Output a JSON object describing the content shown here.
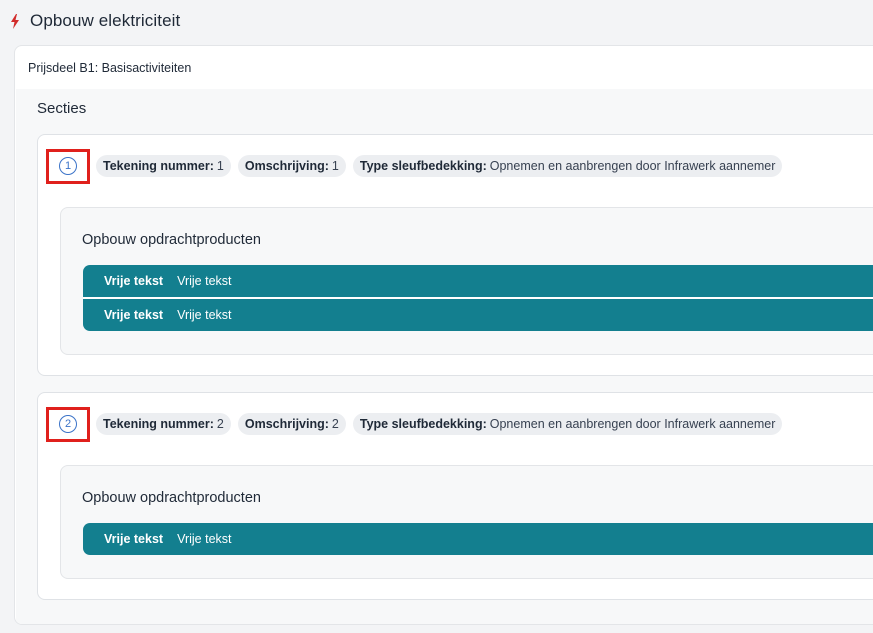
{
  "header": {
    "title": "Opbouw elektriciteit",
    "icon": "lightning-bolt-icon",
    "icon_color": "#d12b2b"
  },
  "card": {
    "title": "Prijsdeel B1: Basisactiviteiten"
  },
  "secties": {
    "title": "Secties",
    "sections": [
      {
        "number": "1",
        "pills": [
          {
            "label": "Tekening nummer:",
            "value": "1"
          },
          {
            "label": "Omschrijving:",
            "value": "1"
          },
          {
            "label": "Type sleufbedekking:",
            "value": "Opnemen en aanbrengen door Infrawerk aannemer"
          }
        ],
        "products_title": "Opbouw opdrachtproducten",
        "rows": [
          {
            "label": "Vrije tekst",
            "value": "Vrije tekst"
          },
          {
            "label": "Vrije tekst",
            "value": "Vrije tekst"
          }
        ]
      },
      {
        "number": "2",
        "pills": [
          {
            "label": "Tekening nummer:",
            "value": "2"
          },
          {
            "label": "Omschrijving:",
            "value": "2"
          },
          {
            "label": "Type sleufbedekking:",
            "value": "Opnemen en aanbrengen door Infrawerk aannemer"
          }
        ],
        "products_title": "Opbouw opdrachtproducten",
        "rows": [
          {
            "label": "Vrije tekst",
            "value": "Vrije tekst"
          }
        ]
      }
    ]
  },
  "colors": {
    "row_bg": "#137f8f",
    "highlight_box": "#e0201c",
    "number_circle": "#3b73c8"
  }
}
